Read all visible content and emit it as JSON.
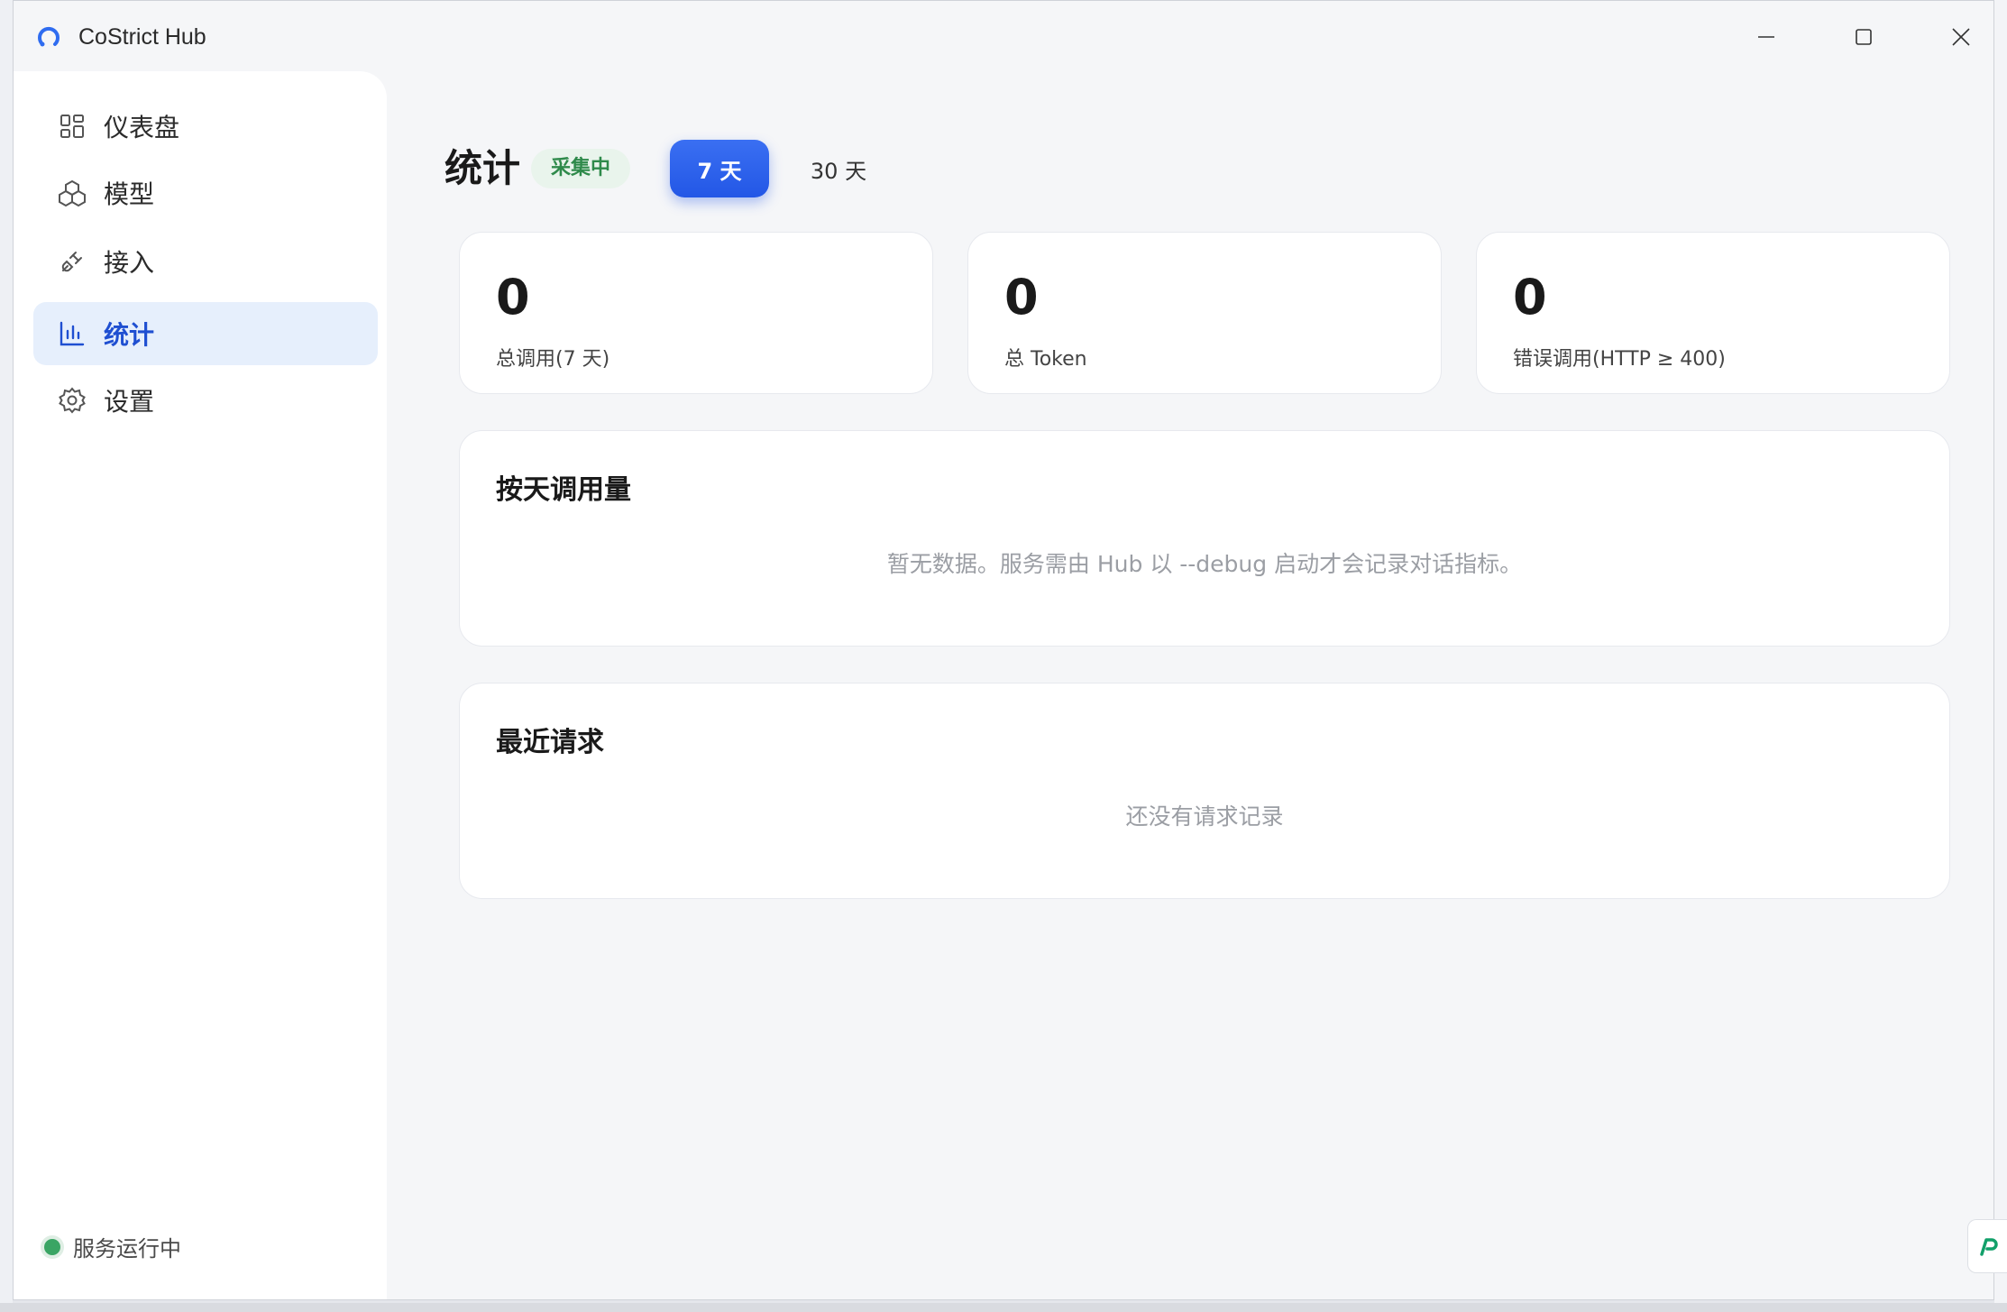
{
  "window": {
    "title": "CoStrict Hub"
  },
  "sidebar": {
    "items": [
      {
        "label": "仪表盘",
        "icon": "dashboard-icon"
      },
      {
        "label": "模型",
        "icon": "models-icon"
      },
      {
        "label": "接入",
        "icon": "plug-icon"
      },
      {
        "label": "统计",
        "icon": "bar-chart-icon",
        "active": true
      },
      {
        "label": "设置",
        "icon": "gear-icon"
      }
    ],
    "status": "服务运行中"
  },
  "main": {
    "title": "统计",
    "badge": "采集中",
    "ranges": [
      {
        "label": "7 天",
        "selected": true
      },
      {
        "label": "30 天",
        "selected": false
      }
    ],
    "stats": [
      {
        "value": "0",
        "label": "总调用(7 天)"
      },
      {
        "value": "0",
        "label": "总 Token"
      },
      {
        "value": "0",
        "label": "错误调用(HTTP ≥ 400)"
      }
    ],
    "daily": {
      "title": "按天调用量",
      "empty": "暂无数据。服务需由 Hub 以 --debug 启动才会记录对话指标。"
    },
    "recent": {
      "title": "最近请求",
      "empty": "还没有请求记录"
    }
  },
  "colors": {
    "accent": "#2357e6",
    "active_nav_bg": "#e6effc",
    "status_green": "#3aa564",
    "badge_bg": "#e9f4ec",
    "badge_text": "#2f8a4b"
  }
}
